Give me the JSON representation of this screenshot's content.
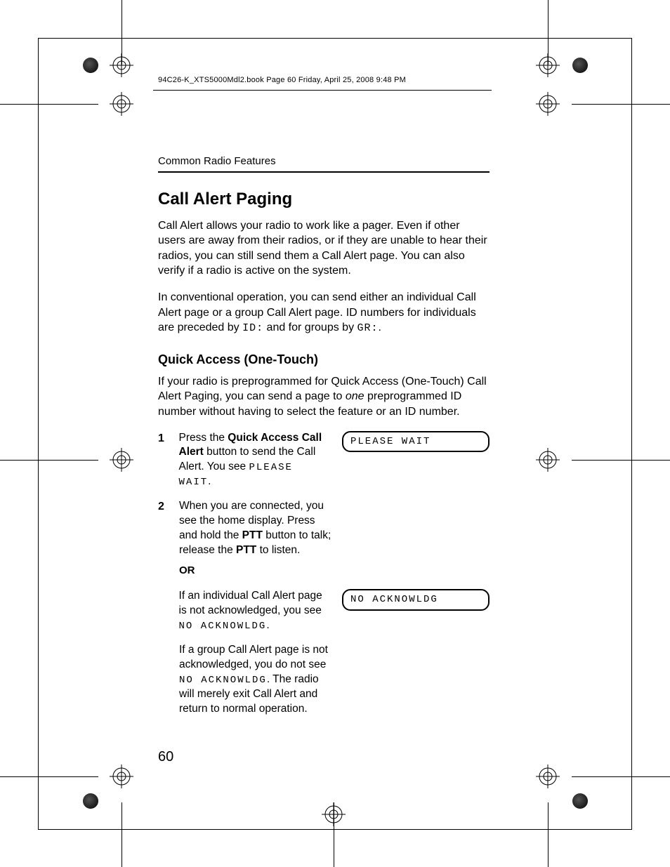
{
  "header": "94C26-K_XTS5000Mdl2.book  Page 60  Friday, April 25, 2008  9:48 PM",
  "section": "Common Radio Features",
  "h1": "Call Alert Paging",
  "p1a": "Call Alert allows your radio to work like a pager. Even if other users are away from their radios, or if they are unable to hear their radios, you can still send them a Call Alert page. You can also verify if a radio is active on the system.",
  "p2a": "In conventional operation, you can send either an individual Call Alert page or a group Call Alert page. ID numbers for individuals are preceded by ",
  "p2_id": "ID:",
  "p2b": " and for groups by ",
  "p2_gr": "GR:",
  "p2c": ".",
  "h2": "Quick Access (One-Touch)",
  "p3a": "If your radio is preprogrammed for Quick Access (One-Touch) Call Alert Paging, you can send a page to ",
  "p3_one": "one",
  "p3b": " preprogrammed ID number without having to select the feature or an ID number.",
  "step1_num": "1",
  "step1_a": "Press the ",
  "step1_bold": "Quick Access Call Alert",
  "step1_b": " button to send the Call Alert. You see ",
  "step1_lcd": "PLEASE WAIT",
  "step1_c": ".",
  "display1": "PLEASE WAIT",
  "step2_num": "2",
  "step2_a": "When you are connected, you see the home display. Press and hold the ",
  "step2_ptt1": "PTT",
  "step2_b": " button to talk; release the ",
  "step2_ptt2": "PTT",
  "step2_c": " to listen.",
  "or": "OR",
  "sub_a1": "If an individual Call Alert page is not acknowledged, you see ",
  "sub_a_lcd": "NO ACKNOWLDG",
  "sub_a2": ".",
  "display2": "NO ACKNOWLDG",
  "sub_b1": "If a group Call Alert page is not acknowledged, you do not see ",
  "sub_b_lcd": "NO ACKNOWLDG",
  "sub_b2": ". The radio will merely exit Call Alert and return to normal operation.",
  "page_num": "60"
}
